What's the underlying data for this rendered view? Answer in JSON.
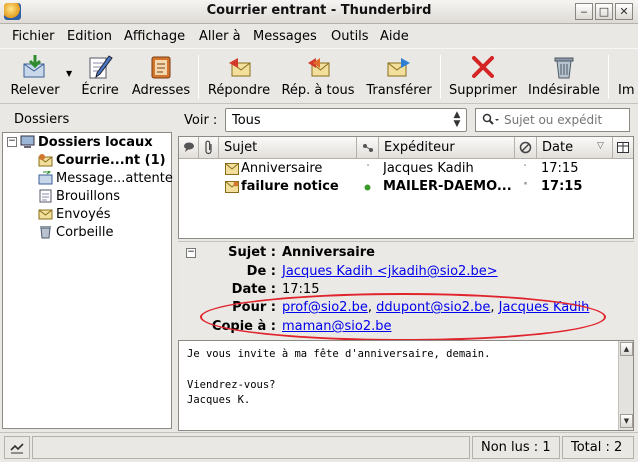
{
  "window": {
    "title": "Courrier entrant - Thunderbird"
  },
  "menu": [
    "Fichier",
    "Edition",
    "Affichage",
    "Aller à",
    "Messages",
    "Outils",
    "Aide"
  ],
  "toolbar": {
    "relever": "Relever",
    "ecrire": "Écrire",
    "adresses": "Adresses",
    "repondre": "Répondre",
    "rep_tous": "Rép. à tous",
    "transferer": "Transférer",
    "supprimer": "Supprimer",
    "indesirable": "Indésirable",
    "overflow": "Im"
  },
  "folders": {
    "header": "Dossiers",
    "root": "Dossiers locaux",
    "items": [
      "Courrie...nt (1)",
      "Message...attente",
      "Brouillons",
      "Envoyés",
      "Corbeille"
    ]
  },
  "view": {
    "label": "Voir :",
    "selected": "Tous"
  },
  "search": {
    "placeholder": "Sujet ou expédit"
  },
  "thread": {
    "columns": {
      "subject": "Sujet",
      "sender": "Expéditeur",
      "date": "Date"
    },
    "rows": [
      {
        "subject": "Anniversaire",
        "sender": "Jacques Kadih",
        "date": "17:15",
        "unread": false
      },
      {
        "subject": "failure notice",
        "sender": "MAILER-DAEMO...",
        "date": "17:15",
        "unread": true
      }
    ]
  },
  "header": {
    "labels": {
      "subject": "Sujet :",
      "from": "De :",
      "date": "Date :",
      "to": "Pour :",
      "cc": "Copie à :"
    },
    "subject": "Anniversaire",
    "from": "Jacques Kadih <jkadih@sio2.be>",
    "date": "17:15",
    "to": [
      "prof@sio2.be",
      "ddupont@sio2.be",
      "Jacques Kadih"
    ],
    "cc": "maman@sio2.be"
  },
  "body": [
    "Je vous invite à ma fête d'anniversaire, demain.",
    "",
    "Viendrez-vous?",
    "Jacques K."
  ],
  "status": {
    "unread": "Non lus : 1",
    "total": "Total : 2"
  },
  "colors": {
    "link": "#0000ee",
    "highlight": "#e0232c"
  }
}
